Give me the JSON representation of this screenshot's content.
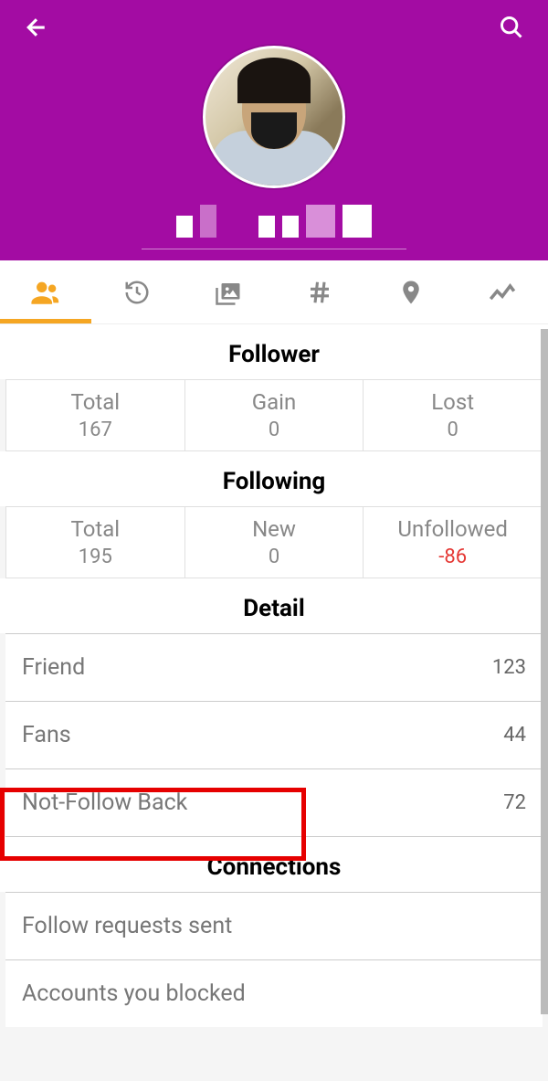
{
  "header": {
    "back_icon": "arrow-back",
    "search_icon": "search"
  },
  "tabs": {
    "people": "people-icon",
    "history": "history-icon",
    "media": "media-icon",
    "hashtag": "hashtag-icon",
    "location": "location-icon",
    "analytics": "analytics-icon"
  },
  "follower": {
    "title": "Follower",
    "cells": [
      {
        "label": "Total",
        "value": "167"
      },
      {
        "label": "Gain",
        "value": "0"
      },
      {
        "label": "Lost",
        "value": "0"
      }
    ]
  },
  "following": {
    "title": "Following",
    "cells": [
      {
        "label": "Total",
        "value": "195"
      },
      {
        "label": "New",
        "value": "0"
      },
      {
        "label": "Unfollowed",
        "value": "-86",
        "red": true
      }
    ]
  },
  "detail": {
    "title": "Detail",
    "rows": [
      {
        "label": "Friend",
        "value": "123"
      },
      {
        "label": "Fans",
        "value": "44"
      },
      {
        "label": "Not-Follow Back",
        "value": "72",
        "highlight": true
      }
    ]
  },
  "connections": {
    "title": "Connections",
    "rows": [
      {
        "label": "Follow requests sent"
      },
      {
        "label": "Accounts you blocked"
      }
    ]
  }
}
